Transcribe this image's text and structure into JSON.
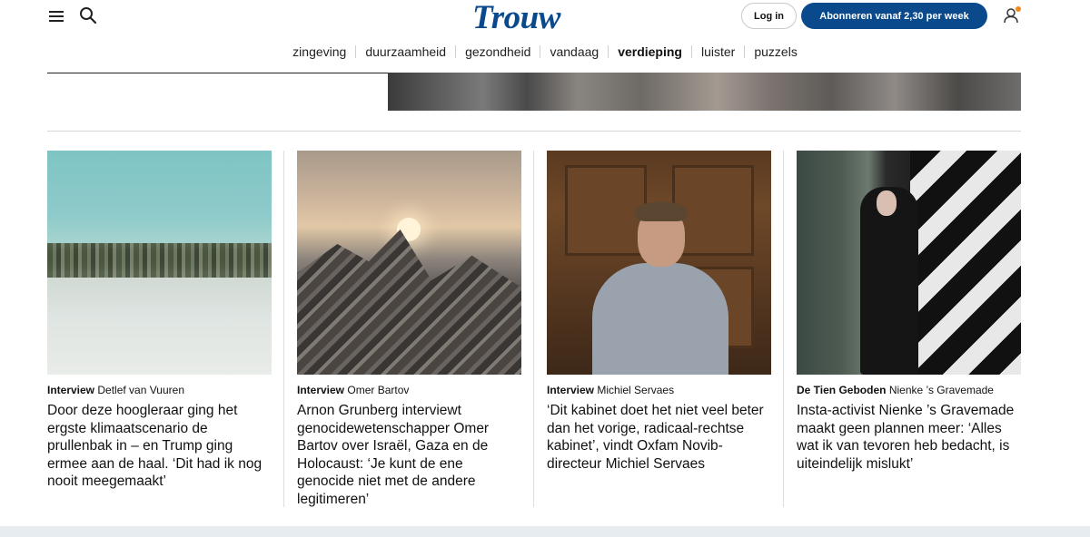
{
  "header": {
    "logo": "Trouw",
    "login_label": "Log in",
    "subscribe_label": "Abonneren vanaf 2,30 per week",
    "icons": [
      "menu-icon",
      "search-icon",
      "user-icon"
    ]
  },
  "nav": {
    "items": [
      {
        "label": "zingeving",
        "active": false
      },
      {
        "label": "duurzaamheid",
        "active": false
      },
      {
        "label": "gezondheid",
        "active": false
      },
      {
        "label": "vandaag",
        "active": false
      },
      {
        "label": "verdieping",
        "active": true
      },
      {
        "label": "luister",
        "active": false
      },
      {
        "label": "puzzels",
        "active": false
      }
    ]
  },
  "cards": [
    {
      "kicker": "Interview",
      "author": "Detlef van Vuuren",
      "title": "Door deze hoogleraar ging het ergste klimaatscenario de prullenbak in – en Trump ging ermee aan de haal. ‘Dit had ik nog nooit meegemaakt’"
    },
    {
      "kicker": "Interview",
      "author": "Omer Bartov",
      "title": "Arnon Grunberg interviewt genocidewetenschapper Omer Bartov over Israël, Gaza en de Holocaust: ‘Je kunt de ene genocide niet met de andere legitimeren’"
    },
    {
      "kicker": "Interview",
      "author": "Michiel Servaes",
      "title": "‘Dit kabinet doet het niet veel beter dan het vorige, radicaal-rechtse kabinet’, vindt Oxfam Novib-directeur Michiel Servaes"
    },
    {
      "kicker": "De Tien Geboden",
      "author": "Nienke ’s Gravemade",
      "title": "Insta-activist Nienke ’s Gravemade maakt geen plannen meer: ‘Alles wat ik van tevoren heb bedacht, is uiteindelijk mislukt’"
    }
  ],
  "colors": {
    "brand": "#0a4a8c",
    "notification": "#f08a1c"
  }
}
